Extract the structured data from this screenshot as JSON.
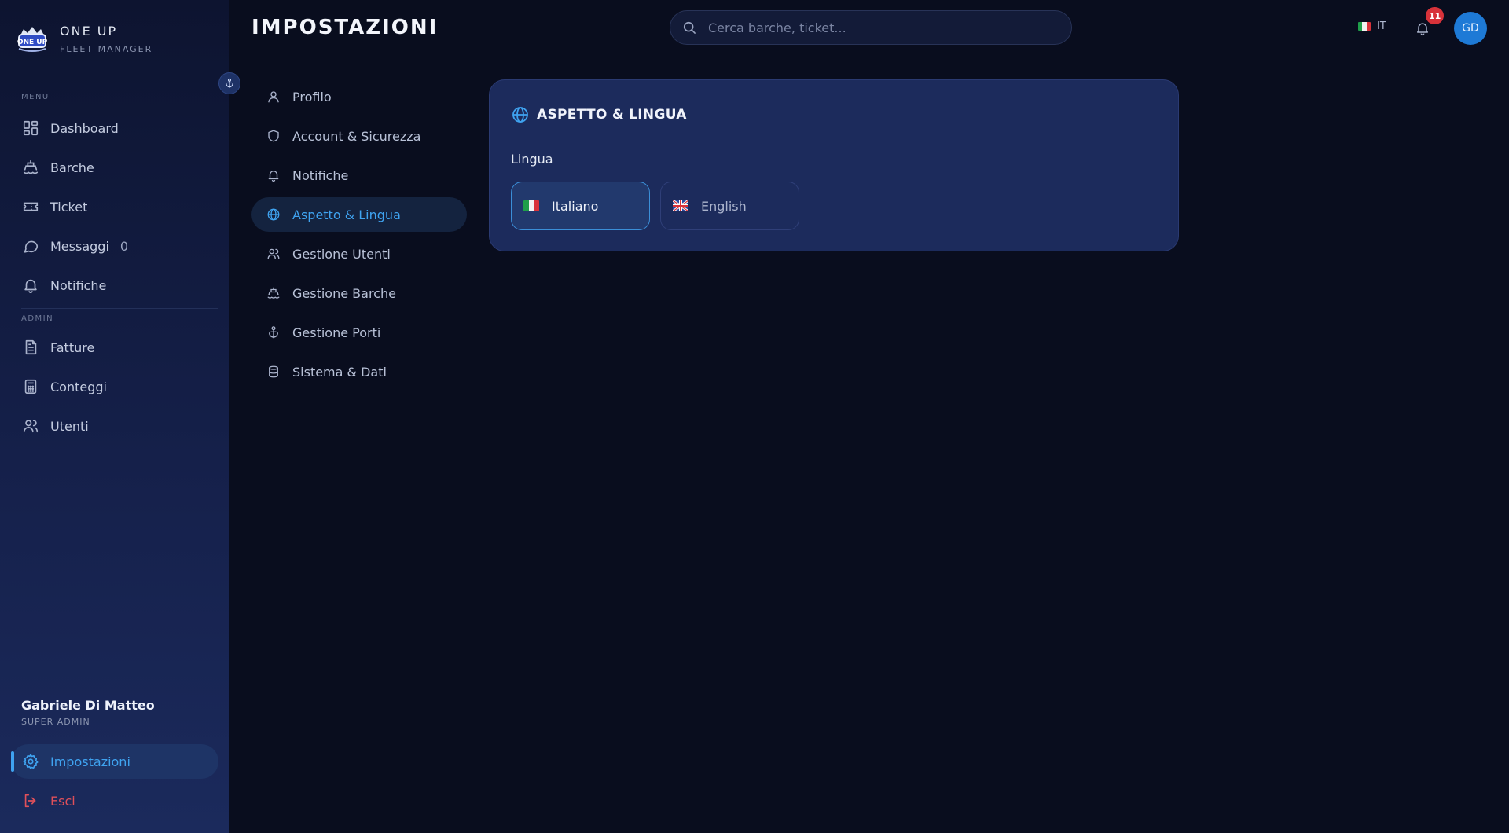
{
  "brand": {
    "name": "ONE UP",
    "subtitle": "FLEET MANAGER",
    "logo_text": "ONE UP"
  },
  "sidebar": {
    "menu_label": "MENU",
    "admin_label": "ADMIN",
    "menu_items": [
      {
        "label": "Dashboard",
        "icon": "dashboard-icon"
      },
      {
        "label": "Barche",
        "icon": "boat-icon"
      },
      {
        "label": "Ticket",
        "icon": "ticket-icon"
      },
      {
        "label": "Messaggi",
        "icon": "message-icon",
        "count": "0"
      },
      {
        "label": "Notifiche",
        "icon": "bell-icon"
      }
    ],
    "admin_items": [
      {
        "label": "Fatture",
        "icon": "invoice-icon"
      },
      {
        "label": "Conteggi",
        "icon": "calculator-icon"
      },
      {
        "label": "Utenti",
        "icon": "users-icon"
      }
    ],
    "user": {
      "name": "Gabriele Di Matteo",
      "role": "SUPER ADMIN"
    },
    "settings_label": "Impostazioni",
    "logout_label": "Esci"
  },
  "header": {
    "title": "IMPOSTAZIONI",
    "search_placeholder": "Cerca barche, ticket...",
    "language_code": "IT",
    "notification_count": "11",
    "avatar_initials": "GD"
  },
  "settings_nav": [
    {
      "label": "Profilo",
      "icon": "user-icon"
    },
    {
      "label": "Account & Sicurezza",
      "icon": "shield-icon"
    },
    {
      "label": "Notifiche",
      "icon": "bell-icon"
    },
    {
      "label": "Aspetto & Lingua",
      "icon": "globe-icon",
      "active": true
    },
    {
      "label": "Gestione Utenti",
      "icon": "users-icon"
    },
    {
      "label": "Gestione Barche",
      "icon": "boat-icon"
    },
    {
      "label": "Gestione Porti",
      "icon": "anchor-icon"
    },
    {
      "label": "Sistema & Dati",
      "icon": "database-icon"
    }
  ],
  "appearance": {
    "title": "ASPETTO & LINGUA",
    "language_label": "Lingua",
    "options": [
      {
        "label": "Italiano",
        "flag": "flag-it",
        "selected": true
      },
      {
        "label": "English",
        "flag": "flag-gb",
        "selected": false
      }
    ]
  },
  "colors": {
    "accent": "#3fa3f0",
    "danger": "#e0505a",
    "badge": "#d8323a",
    "background": "#090d1e",
    "card": "#1c2b5c"
  }
}
